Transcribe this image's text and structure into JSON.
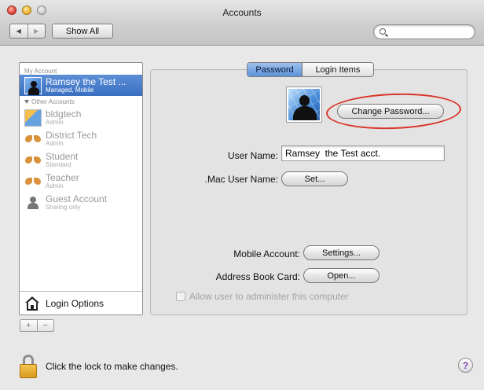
{
  "window": {
    "title": "Accounts",
    "nav_back": "◀",
    "nav_forward": "▶",
    "show_all": "Show All",
    "search_placeholder": ""
  },
  "sidebar": {
    "my_account_header": "My Account",
    "my_account": {
      "name": "Ramsey  the Test ...",
      "role": "Managed, Mobile"
    },
    "other_accounts_header": "Other Accounts",
    "other_accounts": [
      {
        "name": "bldgtech",
        "role": "Admin"
      },
      {
        "name": "District Tech",
        "role": "Admin"
      },
      {
        "name": "Student",
        "role": "Standard"
      },
      {
        "name": "Teacher",
        "role": "Admin"
      },
      {
        "name": "Guest Account",
        "role": "Sharing only"
      }
    ],
    "login_options": "Login Options",
    "add": "+",
    "remove": "−"
  },
  "panel": {
    "tabs": [
      {
        "label": "Password",
        "active": true
      },
      {
        "label": "Login Items",
        "active": false
      }
    ],
    "change_password": "Change Password...",
    "user_name_label": "User Name:",
    "user_name_value": "Ramsey  the Test acct.",
    "mac_user_name_label": ".Mac User Name:",
    "set_button": "Set...",
    "mobile_account_label": "Mobile Account:",
    "settings_button": "Settings...",
    "address_book_label": "Address Book Card:",
    "open_button": "Open...",
    "allow_admin_label": "Allow user to administer this computer",
    "allow_admin_checked": false
  },
  "bottom": {
    "lock_text": "Click the lock to make changes.",
    "help": "?"
  },
  "colors": {
    "selection": "#3a6fc1",
    "highlight_circle": "#d8362a",
    "lock_gold": "#f5c34f"
  }
}
